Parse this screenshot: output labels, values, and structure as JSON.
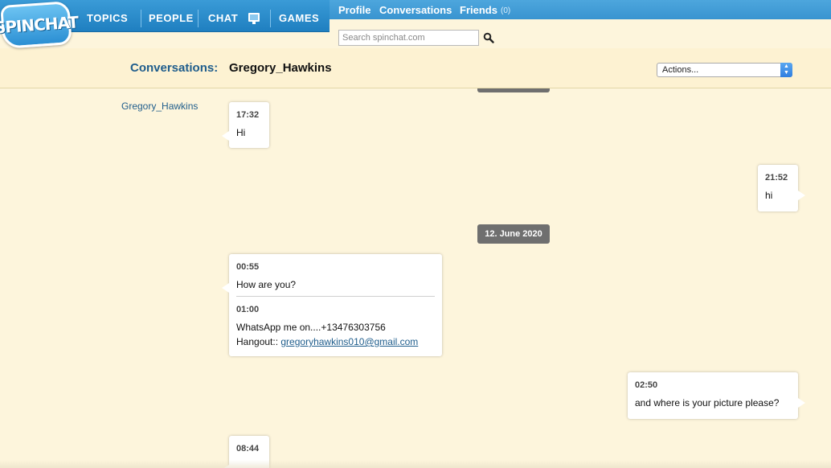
{
  "brand": {
    "logo_text": "SPINCHAT"
  },
  "nav": {
    "items": [
      {
        "label": "TOPICS"
      },
      {
        "label": "PEOPLE"
      },
      {
        "label": "CHAT",
        "icon": "monitor-icon"
      },
      {
        "label": "GAMES"
      }
    ]
  },
  "subnav": {
    "profile": "Profile",
    "conversations": "Conversations",
    "friends": "Friends",
    "friends_count": "(0)"
  },
  "search": {
    "placeholder": "Search spinchat.com",
    "icon": "search-icon"
  },
  "header": {
    "label": "Conversations:",
    "name": "Gregory_Hawkins",
    "actions": "Actions..."
  },
  "conversation": {
    "sender": "Gregory_Hawkins",
    "date_separator": "12. June 2020",
    "messages": [
      {
        "direction": "in",
        "time": "17:32",
        "text": "Hi"
      },
      {
        "direction": "out",
        "time": "21:52",
        "text": "hi"
      },
      {
        "direction": "in",
        "time": "00:55",
        "text": "How are you?"
      },
      {
        "direction": "in",
        "time": "01:00",
        "text_line1": "WhatsApp me on....+13476303756",
        "text_line2_prefix": "Hangout:: ",
        "email": "gregoryhawkins010@gmail.com"
      },
      {
        "direction": "out",
        "time": "02:50",
        "text": "and where is your picture please?"
      },
      {
        "direction": "in",
        "time": "08:44"
      }
    ]
  },
  "colors": {
    "accent_blue": "#1f7fc0",
    "background": "#fdf5dc",
    "date_badge": "#6f6f6f",
    "link": "#1f5d8c"
  }
}
